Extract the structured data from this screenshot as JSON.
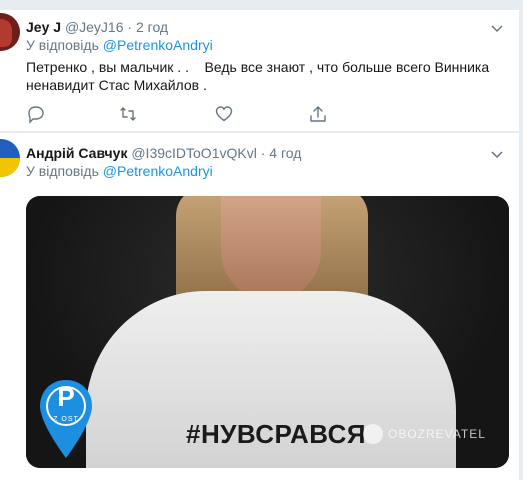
{
  "tweets": [
    {
      "name": "Jey J",
      "handle": "@JeyJ16",
      "separator": "·",
      "time": "2 год",
      "reply_prefix": "У відповідь",
      "reply_to": "@PetrenkoAndryi",
      "text": "Петренко , вы мальчик . .    Ведь все знают , что больше всего Винника ненавидит Стас Михайлов ."
    },
    {
      "name": "Андрій Савчук",
      "handle": "@I39cIDToO1vQKvl",
      "separator": "·",
      "time": "4 год",
      "reply_prefix": "У відповідь",
      "reply_to": "@PetrenkoAndryi",
      "media": {
        "hashtag": "#НУВСРАВСЯ",
        "watermark": "OBOZREVATEL",
        "pin_letter": "P",
        "pin_sub": "Z OST"
      }
    }
  ],
  "colors": {
    "link": "#1b95e0",
    "muted": "#657786",
    "text": "#14171a",
    "page_bg": "#e6ecf0"
  },
  "icons": [
    "chevron-down-icon",
    "reply-icon",
    "retweet-icon",
    "like-icon",
    "share-icon"
  ]
}
